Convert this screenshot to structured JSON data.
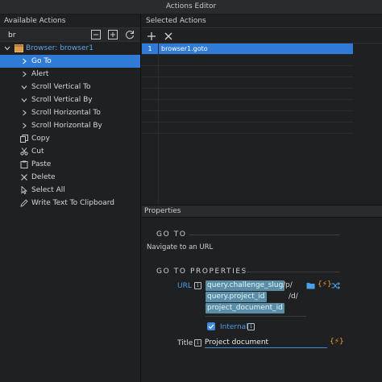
{
  "window": {
    "title": "Actions Editor"
  },
  "left_panel": {
    "header": "Available Actions",
    "search": {
      "value": "br"
    },
    "tree": {
      "root": {
        "label": "Browser: browser1"
      },
      "items": [
        {
          "label": "Go To",
          "icon": "chevron-right-icon",
          "selected": true
        },
        {
          "label": "Alert",
          "icon": "chevron-right-icon"
        },
        {
          "label": "Scroll Vertical To",
          "icon": "chevron-down-icon"
        },
        {
          "label": "Scroll Vertical By",
          "icon": "chevron-down-icon"
        },
        {
          "label": "Scroll Horizontal To",
          "icon": "chevron-right-icon"
        },
        {
          "label": "Scroll Horizontal By",
          "icon": "chevron-right-icon"
        },
        {
          "label": "Copy",
          "icon": "copy-icon"
        },
        {
          "label": "Cut",
          "icon": "scissors-icon"
        },
        {
          "label": "Paste",
          "icon": "paste-icon"
        },
        {
          "label": "Delete",
          "icon": "close-icon"
        },
        {
          "label": "Select All",
          "icon": "cursor-icon"
        },
        {
          "label": "Write Text To Clipboard",
          "icon": "pencil-icon"
        }
      ]
    }
  },
  "right_panel": {
    "header": "Selected Actions",
    "actions": [
      {
        "num": "1",
        "name": "browser1.goto"
      }
    ]
  },
  "properties": {
    "header": "Properties",
    "section1_title": "GO TO",
    "description": "Navigate to an URL",
    "section2_title": "GO TO PROPERTIES",
    "url_label": "URL",
    "info_glyph": "i",
    "url_parts": {
      "chip1": "query.challenge_slug",
      "sep1": "/p/",
      "chip2": "query.project_id",
      "sep2": "/d/",
      "chip3": "project_document_id"
    },
    "expr_glyph": "{⚡}",
    "internal_label": "Internal",
    "title_label": "Title",
    "title_value": "Project document"
  },
  "colors": {
    "accent": "#2f7bd6",
    "chip": "#5a8ea8",
    "expr": "#f0a030"
  }
}
